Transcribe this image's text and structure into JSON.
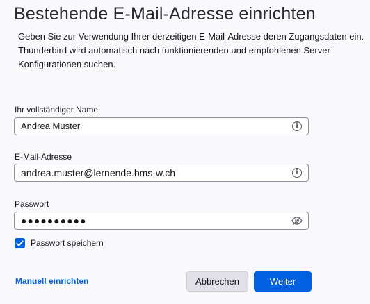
{
  "page": {
    "title": "Bestehende E-Mail-Adresse einrichten",
    "intro_lines": [
      "Geben Sie zur Verwendung Ihrer derzeitigen E-Mail-Adresse deren Zugangsdaten ein.",
      "Thunderbird wird automatisch nach funktionierenden und empfohlenen Server-",
      "Konfigurationen suchen."
    ]
  },
  "form": {
    "name": {
      "label": "Ihr vollständiger Name",
      "value": "Andrea Muster",
      "icon": "info-icon"
    },
    "email": {
      "label": "E-Mail-Adresse",
      "value": "andrea.muster@lernende.bms-w.ch",
      "icon": "info-icon"
    },
    "password": {
      "label": "Passwort",
      "value": "●●●●●●●●●●",
      "icon": "eye-slash-icon"
    },
    "remember": {
      "label": "Passwort speichern",
      "checked": true
    }
  },
  "actions": {
    "manual_link": "Manuell einrichten",
    "cancel": "Abbrechen",
    "next": "Weiter"
  },
  "colors": {
    "accent": "#0061e0",
    "background": "#f9f9fb"
  }
}
